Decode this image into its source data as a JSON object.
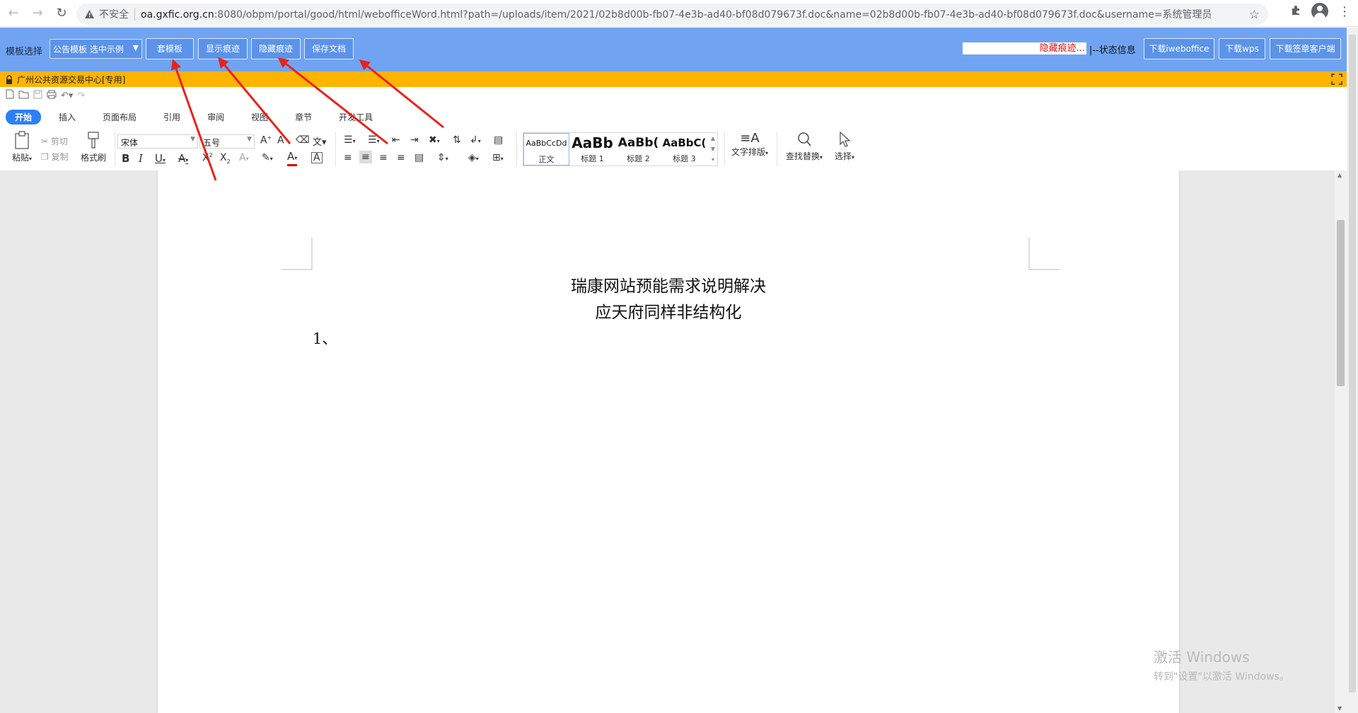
{
  "browser": {
    "insecure_label": "不安全",
    "url_host": "oa.gxfic.org.cn",
    "url_rest": ":8080/obpm/portal/good/html/webofficeWord.html?path=/uploads/item/2021/02b8d00b-fb07-4e3b-ad40-bf08d079673f.doc&name=02b8d00b-fb07-4e3b-ad40-bf08d079673f.doc&username=系统管理员"
  },
  "portal": {
    "template_label": "模板选择",
    "template_select_value": "公告模板 选中示例",
    "buttons": {
      "apply_template": "套模板",
      "show_revisions": "显示痕迹",
      "hide_revisions": "隐藏痕迹",
      "save_document": "保存文档"
    },
    "status_value": "隐藏痕迹...",
    "status_label": "|--状态信息",
    "download_iweboffice": "下载iweboffice",
    "download_wps": "下载wps",
    "download_sign_client": "下载签章客户端"
  },
  "office": {
    "title": "广州公共资源交易中心[专用]",
    "tabs": [
      "开始",
      "插入",
      "页面布局",
      "引用",
      "审阅",
      "视图",
      "章节",
      "开发工具"
    ],
    "paste_label": "粘贴",
    "cut_label": "剪切",
    "copy_label": "复制",
    "format_painter_label": "格式刷",
    "font_name": "宋体",
    "font_size": "五号",
    "styles": [
      {
        "sample": "AaBbCcDd",
        "name": "正文"
      },
      {
        "sample": "AaBb",
        "name": "标题 1"
      },
      {
        "sample": "AaBb(",
        "name": "标题 2"
      },
      {
        "sample": "AaBbC(",
        "name": "标题 3"
      }
    ],
    "text_layout_label": "文字排版",
    "find_replace_label": "查找替换",
    "select_label": "选择"
  },
  "document": {
    "title_line1": "瑞康网站预能需求说明解决",
    "title_line2": "应天府同样非结构化",
    "body_line1": "1、"
  },
  "watermark": {
    "line1": "激活 Windows",
    "line2": "转到\"设置\"以激活 Windows。"
  },
  "colors": {
    "portal_bar": "#70a4f2",
    "orange_bar": "#ffb400",
    "arrow_red": "#e8231b",
    "active_tab": "#2d7ff9"
  }
}
